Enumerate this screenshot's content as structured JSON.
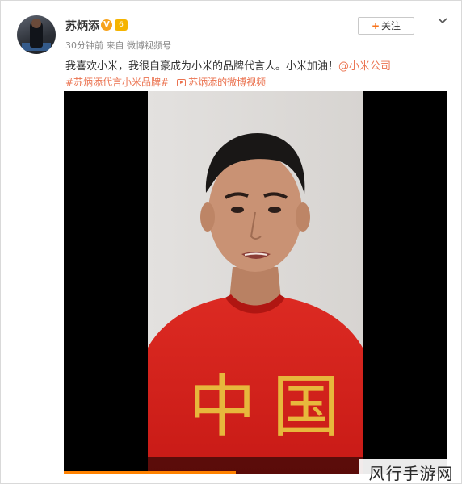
{
  "author": {
    "name": "苏炳添",
    "verified_mark": "V",
    "vip_mark": "6",
    "meta": "30分钟前 来自 微博视频号"
  },
  "follow_label": "关注",
  "post": {
    "text": "我喜欢小米，我很自豪成为小米的品牌代言人。小米加油！",
    "mention": "@小米公司",
    "hashtag": "#苏炳添代言小米品牌#",
    "video_link": "苏炳添的微博视频"
  },
  "video": {
    "shirt_text": "中国",
    "playback_progress": 0.45
  },
  "watermark": "风行手游网",
  "colors": {
    "link": "#eb7350",
    "shirt_red": "#d8201c",
    "gold": "#e7b73c"
  },
  "icons": [
    "avatar",
    "verified-icon",
    "vip-icon",
    "chevron-down-icon",
    "video-icon"
  ]
}
